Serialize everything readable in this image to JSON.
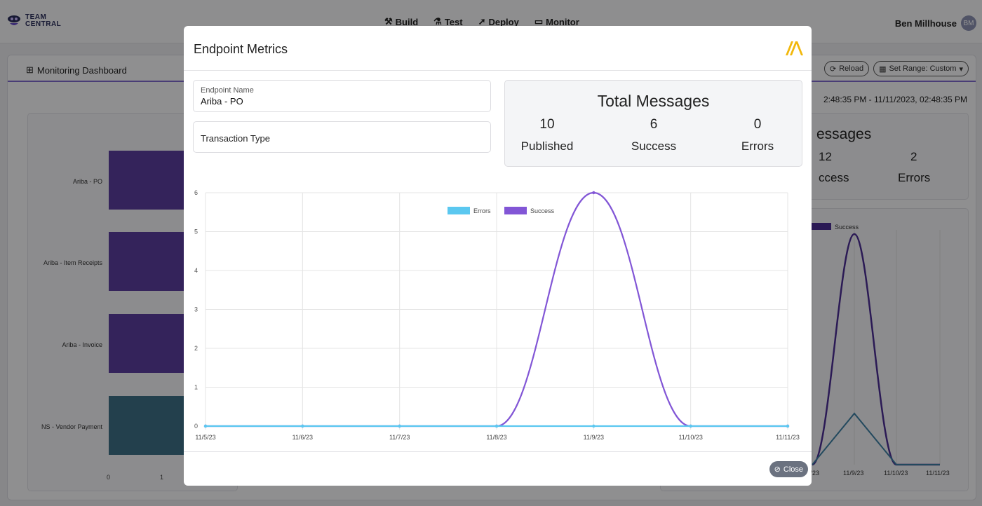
{
  "app": {
    "logo_line1": "TEAM",
    "logo_line2": "CENTRAL",
    "nav": [
      {
        "label": "Build",
        "icon": "hammer-icon"
      },
      {
        "label": "Test",
        "icon": "flask-icon"
      },
      {
        "label": "Deploy",
        "icon": "rocket-icon"
      },
      {
        "label": "Monitor",
        "icon": "monitor-icon"
      }
    ],
    "user_name": "Ben Millhouse",
    "user_initials": "BM"
  },
  "dashboard": {
    "title": "Monitoring Dashboard",
    "reload_label": "Reload",
    "set_range_label": "Set Range: Custom",
    "range_text": "2:48:35 PM - 11/11/2023, 02:48:35 PM",
    "bar_labels": [
      "Ariba - PO",
      "Ariba - Item Receipts",
      "Ariba - Invoice",
      "NS - Vendor Payment"
    ],
    "axis_ticks": [
      "0",
      "1"
    ],
    "totals_partial_title": "essages",
    "success_partial_value": "12",
    "success_partial_label": "ccess",
    "errors_value": "2",
    "errors_label": "Errors",
    "legend_success": "Success",
    "x_ticks_partial": [
      "/8/23",
      "11/9/23",
      "11/10/23",
      "11/11/23"
    ]
  },
  "modal": {
    "title": "Endpoint Metrics",
    "endpoint_name_label": "Endpoint Name",
    "endpoint_name_value": "Ariba - PO",
    "transaction_type_label": "Transaction Type",
    "totals_title": "Total Messages",
    "published_value": "10",
    "published_label": "Published",
    "success_value": "6",
    "success_label": "Success",
    "errors_value": "0",
    "errors_label": "Errors",
    "close_label": "Close",
    "colors": {
      "errors": "#5bc8f0",
      "success": "#8256d6",
      "accent": "#f2b80c"
    }
  },
  "chart_data": {
    "type": "line",
    "categories": [
      "11/5/23",
      "11/6/23",
      "11/7/23",
      "11/8/23",
      "11/9/23",
      "11/10/23",
      "11/11/23"
    ],
    "series": [
      {
        "name": "Errors",
        "values": [
          0,
          0,
          0,
          0,
          0,
          0,
          0
        ]
      },
      {
        "name": "Success",
        "values": [
          0,
          0,
          0,
          0,
          6,
          0,
          0
        ]
      }
    ],
    "ylim": [
      0,
      6
    ],
    "yticks": [
      "0",
      "1",
      "2",
      "3",
      "4",
      "5",
      "6"
    ],
    "legend": "top-center",
    "grid": true
  }
}
